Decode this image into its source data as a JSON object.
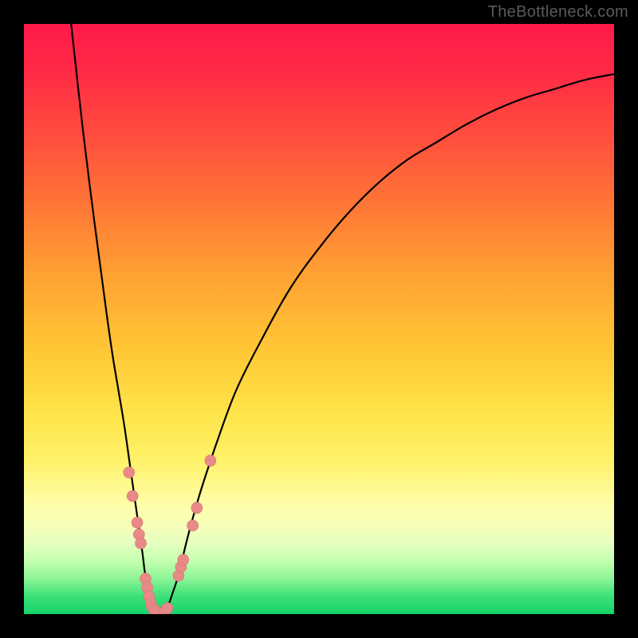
{
  "watermark": "TheBottleneck.com",
  "colors": {
    "curve_stroke": "#000000",
    "marker_fill": "#e98a88",
    "marker_stroke": "#d07472",
    "frame": "#000000"
  },
  "chart_data": {
    "type": "line",
    "title": "",
    "xlabel": "",
    "ylabel": "",
    "xlim": [
      0,
      100
    ],
    "ylim": [
      0,
      100
    ],
    "grid": false,
    "legend": false,
    "series": [
      {
        "name": "left-branch",
        "x": [
          8,
          10,
          12,
          14,
          15,
          16,
          17,
          18,
          19,
          20,
          20.5,
          21,
          21.5,
          22
        ],
        "y": [
          100,
          82,
          66,
          51,
          44,
          38,
          32,
          25,
          18,
          11,
          7,
          4,
          2,
          0
        ]
      },
      {
        "name": "right-branch",
        "x": [
          24,
          25,
          26,
          27,
          28,
          30,
          33,
          36,
          40,
          45,
          50,
          55,
          60,
          65,
          70,
          75,
          80,
          85,
          90,
          95,
          100
        ],
        "y": [
          0,
          3,
          6,
          10,
          14,
          21,
          30,
          38,
          46,
          55,
          62,
          68,
          73,
          77,
          80,
          83,
          85.5,
          87.5,
          89,
          90.5,
          91.5
        ]
      }
    ],
    "note": "The two branches form a V-shaped curve; minimum (~0) occurs around x≈22–24. y-values are in percent-style units (0 green/good to 100 red/bad) with no axis tick labels displayed.",
    "markers": [
      {
        "branch": "left",
        "x": 17.8,
        "y": 24.0
      },
      {
        "branch": "left",
        "x": 18.4,
        "y": 20.0
      },
      {
        "branch": "left",
        "x": 19.2,
        "y": 15.5
      },
      {
        "branch": "left",
        "x": 19.5,
        "y": 13.5
      },
      {
        "branch": "left",
        "x": 19.8,
        "y": 12.0
      },
      {
        "branch": "left",
        "x": 20.6,
        "y": 6.0
      },
      {
        "branch": "left",
        "x": 20.9,
        "y": 4.5
      },
      {
        "branch": "left",
        "x": 21.2,
        "y": 3.0
      },
      {
        "branch": "left",
        "x": 21.5,
        "y": 1.8
      },
      {
        "branch": "left",
        "x": 21.7,
        "y": 1.2
      },
      {
        "branch": "left",
        "x": 22.0,
        "y": 0.8
      },
      {
        "branch": "left",
        "x": 22.4,
        "y": 0.5
      },
      {
        "branch": "left",
        "x": 22.8,
        "y": 0.2
      },
      {
        "branch": "right",
        "x": 23.5,
        "y": 0.2
      },
      {
        "branch": "right",
        "x": 23.9,
        "y": 0.5
      },
      {
        "branch": "right",
        "x": 24.3,
        "y": 1.0
      },
      {
        "branch": "right",
        "x": 26.2,
        "y": 6.5
      },
      {
        "branch": "right",
        "x": 26.6,
        "y": 8.0
      },
      {
        "branch": "right",
        "x": 27.0,
        "y": 9.2
      },
      {
        "branch": "right",
        "x": 28.6,
        "y": 15.0
      },
      {
        "branch": "right",
        "x": 29.3,
        "y": 18.0
      },
      {
        "branch": "right",
        "x": 31.6,
        "y": 26.0
      }
    ]
  }
}
